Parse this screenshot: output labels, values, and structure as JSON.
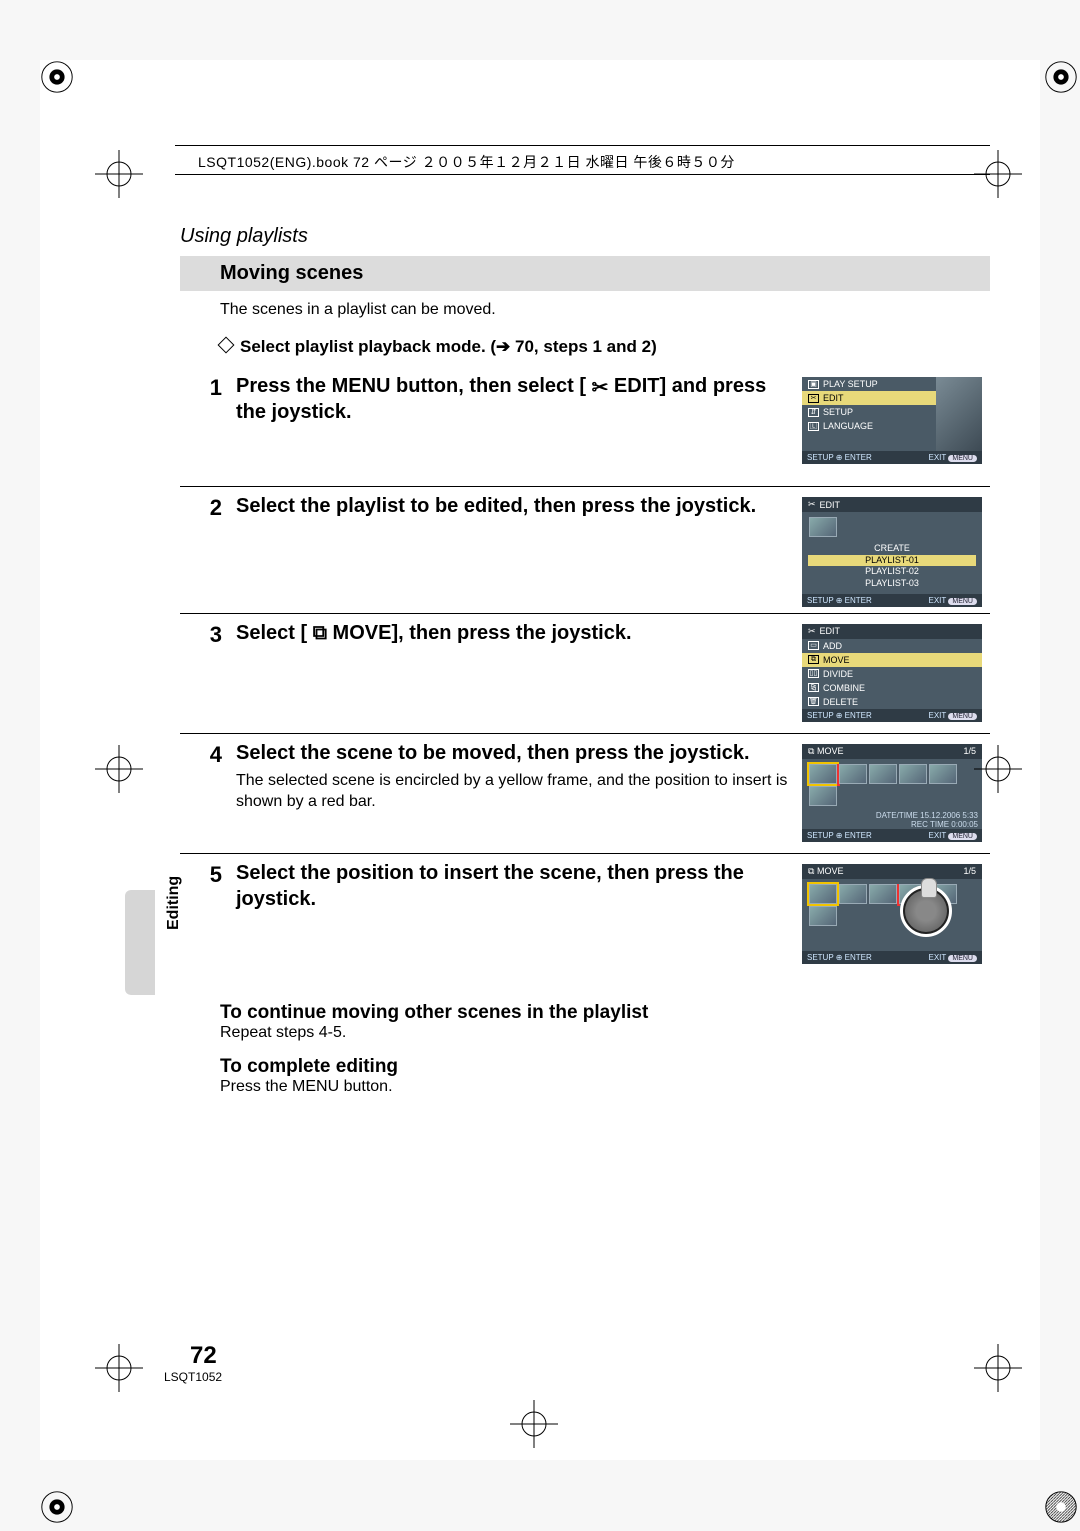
{
  "header": "LSQT1052(ENG).book  72 ページ  ２００５年１２月２１日  水曜日  午後６時５０分",
  "breadcrumb": "Using playlists",
  "section_title": "Moving scenes",
  "intro": "The scenes in a playlist can be moved.",
  "prelim": "Select playlist playback mode. (",
  "prelim_ref": " 70, steps 1 and 2)",
  "side_label": "Editing",
  "page_number": "72",
  "doc_code": "LSQT1052",
  "steps": [
    {
      "num": "1",
      "title_pre": "Press the MENU button, then select [ ",
      "title_icon": "✂",
      "title_post": " EDIT] and press the joystick."
    },
    {
      "num": "2",
      "title": "Select the playlist to be edited, then press the joystick."
    },
    {
      "num": "3",
      "title_pre": "Select [ ",
      "title_icon": "⧉",
      "title_post": " MOVE], then press the joystick."
    },
    {
      "num": "4",
      "title": "Select the scene to be moved, then press the joystick.",
      "sub": "The selected scene is encircled by a yellow frame, and the position to insert is shown by a red bar."
    },
    {
      "num": "5",
      "title": "Select the position to insert the scene, then press the joystick."
    }
  ],
  "tail": [
    {
      "head": "To continue moving other scenes in the playlist",
      "body": "Repeat steps 4-5."
    },
    {
      "head": "To complete editing",
      "body": "Press the MENU button."
    }
  ],
  "shots": {
    "s1": {
      "rows": [
        {
          "icon": "▣",
          "label": "PLAY SETUP"
        },
        {
          "icon": "✂",
          "label": "EDIT",
          "sel": true
        },
        {
          "icon": "⇵",
          "label": "SETUP"
        },
        {
          "icon": "🄻",
          "label": "LANGUAGE"
        }
      ],
      "foot_left": "SETUP ⊕ ENTER",
      "foot_right_label": "EXIT",
      "foot_right_pill": "MENU"
    },
    "s2": {
      "title_icon": "✂",
      "title": "EDIT",
      "list": [
        "CREATE",
        "PLAYLIST-01",
        "PLAYLIST-02",
        "PLAYLIST-03"
      ],
      "sel_index": 1,
      "foot_left": "SETUP ⊕ ENTER",
      "foot_right_label": "EXIT",
      "foot_right_pill": "MENU"
    },
    "s3": {
      "title_icon": "✂",
      "title": "EDIT",
      "rows": [
        {
          "icon": "▭",
          "label": "ADD"
        },
        {
          "icon": "⧉",
          "label": "MOVE",
          "sel": true
        },
        {
          "icon": "▯▯",
          "label": "DIVIDE"
        },
        {
          "icon": "⧎",
          "label": "COMBINE"
        },
        {
          "icon": "🗑",
          "label": "DELETE"
        }
      ],
      "foot_left": "SETUP ⊕ ENTER",
      "foot_right_label": "EXIT",
      "foot_right_pill": "MENU"
    },
    "s4": {
      "title_icon": "⧉",
      "title": "MOVE",
      "counter": "1/5",
      "dt1": "DATE/TIME 15.12.2006   5:33",
      "dt2": "REC TIME 0:00:05",
      "foot_left": "SETUP ⊕ ENTER",
      "foot_right_label": "EXIT",
      "foot_right_pill": "MENU"
    },
    "s5": {
      "title_icon": "⧉",
      "title": "MOVE",
      "counter": "1/5",
      "foot_left": "SETUP ⊕ ENTER",
      "foot_right_label": "EXIT",
      "foot_right_pill": "MENU"
    }
  }
}
